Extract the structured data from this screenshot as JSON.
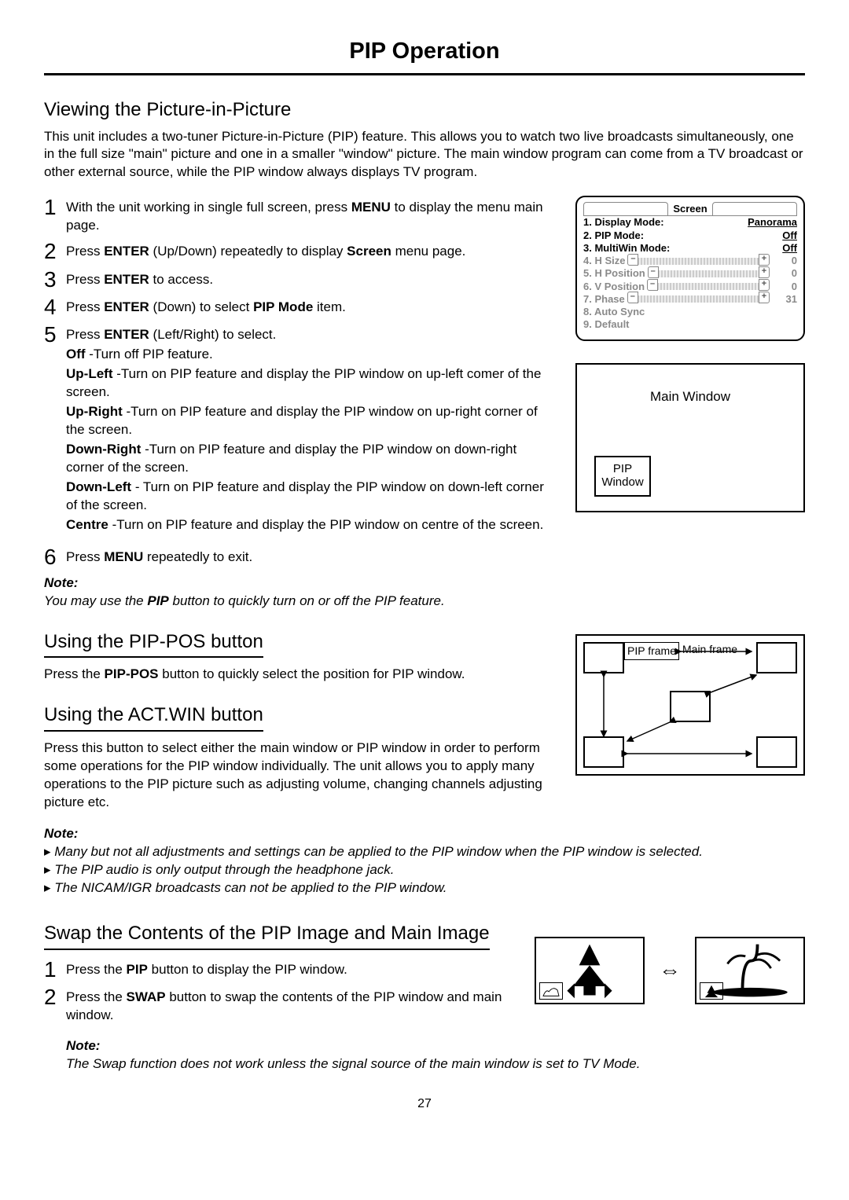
{
  "page_title": "PIP Operation",
  "section1": {
    "heading": "Viewing the Picture-in-Picture",
    "intro": "This unit includes a two-tuner Picture-in-Picture (PIP) feature. This allows you to watch two live broadcasts simultaneously, one in the full size \"main\" picture and one in a smaller \"window\" picture. The main window program can come from a TV broadcast or other external source, while the PIP window always displays TV program.",
    "steps": [
      {
        "n": "1",
        "pre": "With the unit working in single full screen, press ",
        "b1": "MENU",
        "post": " to display the menu main page."
      },
      {
        "n": "2",
        "pre": "Press ",
        "b1": "ENTER",
        "mid": " (Up/Down) repeatedly to display ",
        "b2": "Screen",
        "post": " menu page."
      },
      {
        "n": "3",
        "pre": "Press ",
        "b1": "ENTER",
        "post": " to access."
      },
      {
        "n": "4",
        "pre": "Press ",
        "b1": "ENTER",
        "mid": " (Down) to select ",
        "b2": "PIP Mode",
        "post": " item."
      },
      {
        "n": "5",
        "pre": "Press ",
        "b1": "ENTER",
        "post": " (Left/Right) to select."
      },
      {
        "n": "6",
        "pre": "Press ",
        "b1": "MENU",
        "post": " repeatedly to exit."
      }
    ],
    "options": [
      {
        "name": "Off",
        "desc": " -Turn off PIP feature."
      },
      {
        "name": "Up-Left",
        "desc": " -Turn on PIP feature and display the PIP window on up-left comer of the screen."
      },
      {
        "name": "Up-Right",
        "desc": " -Turn on PIP feature and display the PIP window on up-right corner of the screen."
      },
      {
        "name": "Down-Right",
        "desc": " -Turn on PIP feature and display the PIP window on down-right corner of the screen."
      },
      {
        "name": "Down-Left",
        "desc": " - Turn on PIP feature and display the PIP window on down-left corner of the screen."
      },
      {
        "name": "Centre",
        "desc": " -Turn on PIP feature and display the PIP window on centre of the screen."
      }
    ],
    "note_head": "Note:",
    "note_pre": "You may use the ",
    "note_b": "PIP",
    "note_post": " button to quickly turn on or off the PIP feature."
  },
  "osd": {
    "title": "Screen",
    "rows": [
      {
        "label": "1. Display Mode:",
        "value": "Panorama",
        "dim": false,
        "slider": false,
        "underline": true
      },
      {
        "label": "2. PIP Mode:",
        "value": "Off",
        "dim": false,
        "slider": false,
        "underline": true
      },
      {
        "label": "3. MultiWin Mode:",
        "value": "Off",
        "dim": false,
        "slider": false,
        "underline": true
      },
      {
        "label": "4. H Size",
        "value": "0",
        "dim": true,
        "slider": true
      },
      {
        "label": "5. H Position",
        "value": "0",
        "dim": true,
        "slider": true
      },
      {
        "label": "6. V Position",
        "value": "0",
        "dim": true,
        "slider": true
      },
      {
        "label": "7. Phase",
        "value": "31",
        "dim": true,
        "slider": true
      },
      {
        "label": "8. Auto Sync",
        "value": "",
        "dim": true,
        "slider": false
      },
      {
        "label": "9. Default",
        "value": "",
        "dim": true,
        "slider": false
      }
    ]
  },
  "diagram1": {
    "main": "Main Window",
    "pip": "PIP Window"
  },
  "pippos": {
    "heading": "Using the PIP-POS button",
    "text_pre": "Press the ",
    "text_b": "PIP-POS",
    "text_post": " button to quickly select the position for PIP window.",
    "pip_frame_label": "PIP frame",
    "main_frame_label": "Main frame"
  },
  "actwin": {
    "heading": "Using the ACT.WIN button",
    "text": "Press this button to select either the main window or PIP window in order to perform some operations for the PIP window individually. The unit allows you to apply many operations to the PIP picture such as adjusting volume, changing channels adjusting picture etc.",
    "note_head": "Note:",
    "bullets": [
      "Many but not all adjustments and settings can be applied to the PIP window when the PIP window is selected.",
      "The PIP audio is only output through the headphone jack.",
      "The NICAM/IGR broadcasts can not be applied to the PIP window."
    ]
  },
  "swap": {
    "heading": "Swap the Contents of the PIP Image and Main Image",
    "steps": [
      {
        "n": "1",
        "pre": "Press the ",
        "b1": "PIP",
        "post": " button to display the PIP window."
      },
      {
        "n": "2",
        "pre": "Press the ",
        "b1": "SWAP",
        "post": " button to swap the contents of the PIP window and main window."
      }
    ],
    "note_head": "Note:",
    "note": "The Swap function does not work unless the signal source of the main window is set to TV Mode."
  },
  "page_number": "27"
}
